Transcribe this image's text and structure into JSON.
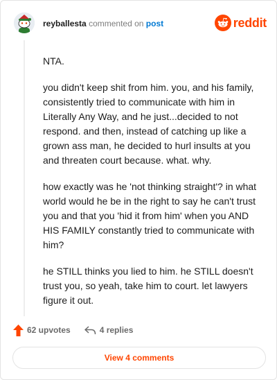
{
  "header": {
    "username": "reyballesta",
    "commented_on": "commented on",
    "post_link": "post",
    "brand": "reddit"
  },
  "comment": {
    "paragraphs": [
      "NTA.",
      "you didn't keep shit from him. you, and his family, consistently tried to communicate with him in Literally Any Way, and he just...decided to not respond. and then, instead of catching up like a grown ass man, he decided to hurl insults at you and threaten court because. what. why.",
      "how exactly was he 'not thinking straight'? in what world would he be in the right to say he can't trust you and that you 'hid it from him' when you AND HIS FAMILY constantly tried to communicate with him?",
      "he STILL thinks you lied to him. he STILL doesn't trust you, so yeah, take him to court. let lawyers figure it out."
    ]
  },
  "actions": {
    "upvotes": "62 upvotes",
    "replies": "4 replies"
  },
  "footer": {
    "view_comments": "View 4 comments"
  },
  "colors": {
    "brand": "#ff4500",
    "link": "#0079d3"
  }
}
